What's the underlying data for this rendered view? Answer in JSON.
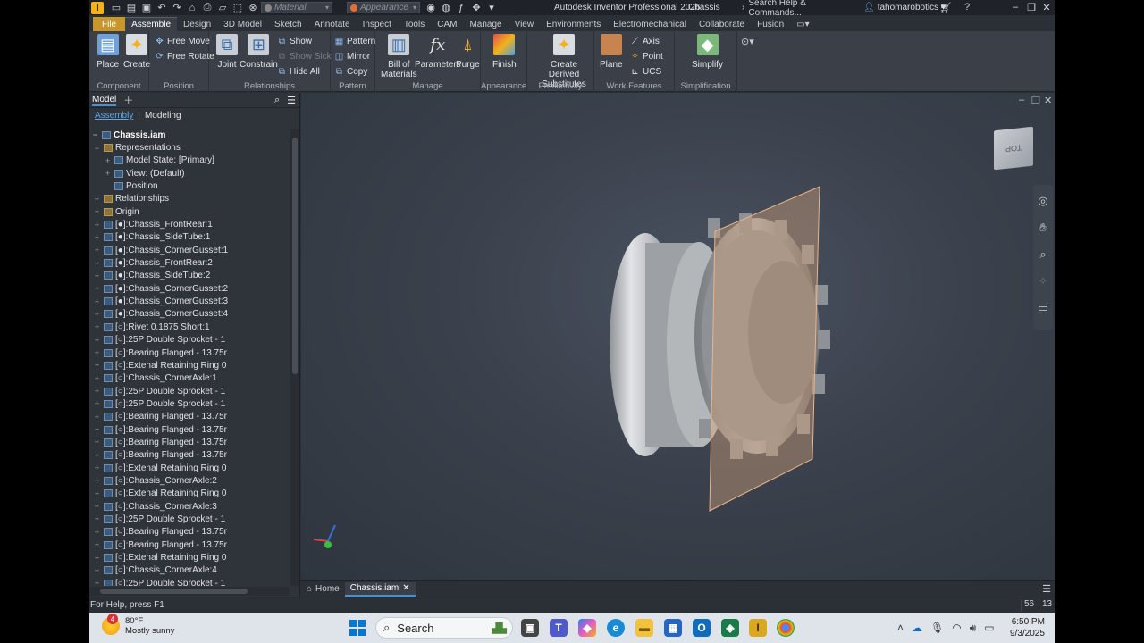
{
  "titlebar": {
    "logo": "I",
    "material_placeholder": "Material",
    "appearance_placeholder": "Appearance",
    "app_title": "Autodesk Inventor Professional 2026",
    "document": "Chassis",
    "search_help": "Search Help & Commands...",
    "user": "tahomarobotics"
  },
  "ribbon_tabs": [
    "File",
    "Assemble",
    "Design",
    "3D Model",
    "Sketch",
    "Annotate",
    "Inspect",
    "Tools",
    "CAM",
    "Manage",
    "View",
    "Environments",
    "Electromechanical",
    "Collaborate",
    "Fusion"
  ],
  "active_tab": "Assemble",
  "ribbon": {
    "component": {
      "label": "Component",
      "place": "Place",
      "create": "Create"
    },
    "position": {
      "label": "Position",
      "free_move": "Free Move",
      "free_rotate": "Free Rotate"
    },
    "relationships": {
      "label": "Relationships",
      "joint": "Joint",
      "constrain": "Constrain",
      "show": "Show",
      "show_sick": "Show Sick",
      "hide_all": "Hide All"
    },
    "pattern": {
      "label": "Pattern",
      "pattern": "Pattern",
      "mirror": "Mirror",
      "copy": "Copy"
    },
    "manage": {
      "label": "Manage",
      "bom": "Bill of\nMaterials",
      "bom_line1": "Bill of",
      "bom_line2": "Materials",
      "parameters": "Parameters",
      "purge": "Purge"
    },
    "appearance": {
      "label": "Appearance",
      "finish": "Finish"
    },
    "productivity": {
      "label": "Productivity",
      "line1": "Create Derived",
      "line2": "Substitutes"
    },
    "work_features": {
      "label": "Work Features",
      "plane": "Plane",
      "axis": "Axis",
      "point": "Point",
      "ucs": "UCS"
    },
    "simplification": {
      "label": "Simplification",
      "simplify": "Simplify"
    }
  },
  "browser": {
    "title": "Model",
    "sub_tab_active": "Assembly",
    "sub_tab_other": "Modeling",
    "root": "Chassis.iam",
    "items": [
      "Representations",
      "Model State: [Primary]",
      "View: (Default)",
      "Position",
      "Relationships",
      "Origin",
      "[●]:Chassis_FrontRear:1",
      "[●]:Chassis_SideTube:1",
      "[●]:Chassis_CornerGusset:1",
      "[●]:Chassis_FrontRear:2",
      "[●]:Chassis_SideTube:2",
      "[●]:Chassis_CornerGusset:2",
      "[●]:Chassis_CornerGusset:3",
      "[●]:Chassis_CornerGusset:4",
      "[○]:Rivet 0.1875 Short:1",
      "[○]:25P Double Sprocket - 1",
      "[○]:Bearing Flanged - 13.75r",
      "[○]:Extenal Retaining Ring 0",
      "[○]:Chassis_CornerAxle:1",
      "[○]:25P Double Sprocket - 1",
      "[○]:25P Double Sprocket - 1",
      "[○]:Bearing Flanged - 13.75r",
      "[○]:Bearing Flanged - 13.75r",
      "[○]:Bearing Flanged - 13.75r",
      "[○]:Bearing Flanged - 13.75r",
      "[○]:Extenal Retaining Ring 0",
      "[○]:Chassis_CornerAxle:2",
      "[○]:Extenal Retaining Ring 0",
      "[○]:Chassis_CornerAxle:3",
      "[○]:25P Double Sprocket - 1",
      "[○]:Bearing Flanged - 13.75r",
      "[○]:Bearing Flanged - 13.75r",
      "[○]:Extenal Retaining Ring 0",
      "[○]:Chassis_CornerAxle:4",
      "[○]:25P Double Sprocket - 1"
    ]
  },
  "viewport": {
    "viewcube_label": "TOP"
  },
  "doc_tabs": {
    "home": "Home",
    "active": "Chassis.iam"
  },
  "status": {
    "text": "For Help, press F1",
    "num1": "56",
    "num2": "13"
  },
  "taskbar": {
    "weather_badge": "4",
    "temp": "80°F",
    "condition": "Mostly sunny",
    "search": "Search",
    "time": "6:50 PM",
    "date": "9/3/2025"
  }
}
